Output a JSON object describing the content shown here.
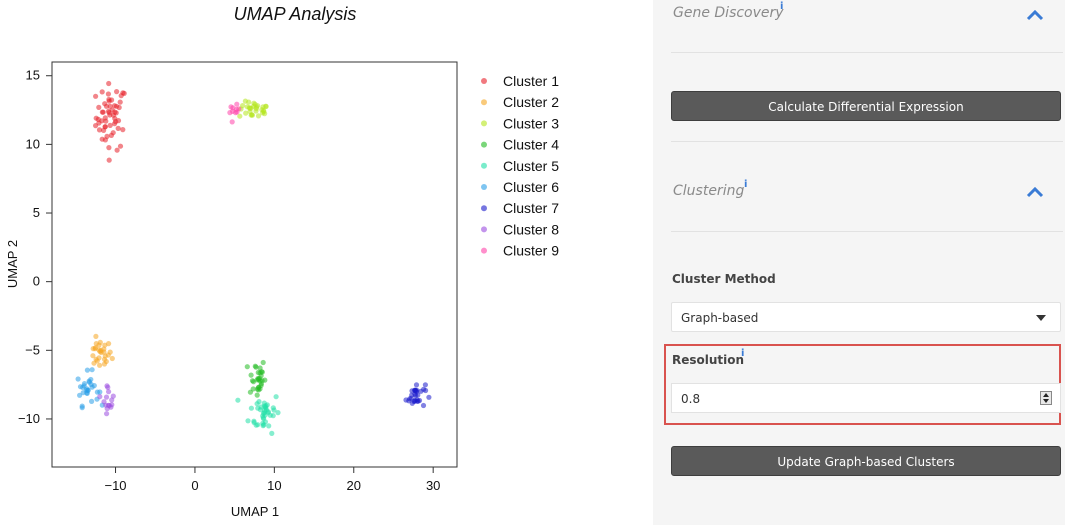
{
  "chart_data": {
    "type": "scatter",
    "title": "UMAP Analysis",
    "xlabel": "UMAP 1",
    "ylabel": "UMAP 2",
    "xlim": [
      -18,
      33
    ],
    "ylim": [
      -13.5,
      16
    ],
    "xticks": [
      -10,
      0,
      10,
      20,
      30
    ],
    "yticks": [
      15,
      10,
      5,
      0,
      -5,
      -10
    ],
    "xtick_labels": [
      "−10",
      "0",
      "10",
      "20",
      "30"
    ],
    "ytick_labels": [
      "15",
      "10",
      "5",
      "0",
      "−5",
      "−10"
    ],
    "grid": false,
    "legend_position": "right",
    "series": [
      {
        "name": "Cluster 1",
        "color": "#e8202a",
        "center": [
          -10.5,
          12.0
        ],
        "spread": [
          1.3,
          1.6
        ],
        "n": 55
      },
      {
        "name": "Cluster 2",
        "color": "#f5a623",
        "center": [
          -12.0,
          -5.3
        ],
        "spread": [
          1.0,
          0.7
        ],
        "n": 28
      },
      {
        "name": "Cluster 3",
        "color": "#b5e61d",
        "center": [
          7.5,
          12.5
        ],
        "spread": [
          1.3,
          0.4
        ],
        "n": 30
      },
      {
        "name": "Cluster 4",
        "color": "#22bb22",
        "center": [
          7.8,
          -7.0
        ],
        "spread": [
          0.7,
          1.0
        ],
        "n": 30
      },
      {
        "name": "Cluster 5",
        "color": "#22e0a8",
        "center": [
          8.8,
          -9.5
        ],
        "spread": [
          1.3,
          1.0
        ],
        "n": 40
      },
      {
        "name": "Cluster 6",
        "color": "#2a9fe8",
        "center": [
          -13.5,
          -7.8
        ],
        "spread": [
          0.9,
          0.8
        ],
        "n": 28
      },
      {
        "name": "Cluster 7",
        "color": "#1b1bcc",
        "center": [
          27.8,
          -8.3
        ],
        "spread": [
          0.8,
          0.6
        ],
        "n": 30
      },
      {
        "name": "Cluster 8",
        "color": "#9b4de0",
        "center": [
          -10.9,
          -8.5
        ],
        "spread": [
          0.5,
          0.7
        ],
        "n": 15
      },
      {
        "name": "Cluster 9",
        "color": "#ff44aa",
        "center": [
          5.0,
          12.4
        ],
        "spread": [
          0.4,
          0.3
        ],
        "n": 10
      }
    ]
  },
  "sidebar": {
    "gene_discovery": {
      "title": "Gene Discovery",
      "info": "i",
      "button_label": "Calculate Differential Expression"
    },
    "clustering": {
      "title": "Clustering",
      "info": "i",
      "method_label": "Cluster Method",
      "method_value": "Graph-based",
      "resolution_label": "Resolution",
      "resolution_info": "i",
      "resolution_value": "0.8",
      "update_button_label": "Update Graph-based Clusters"
    },
    "colors": {
      "accent": "#3a7bd5",
      "button_bg": "#5a5a5a",
      "highlight_border": "#d9534f"
    },
    "icons": {
      "collapse": "chevron-up-icon",
      "dropdown": "caret-down-icon",
      "spinner": "number-spinner-icon"
    }
  }
}
